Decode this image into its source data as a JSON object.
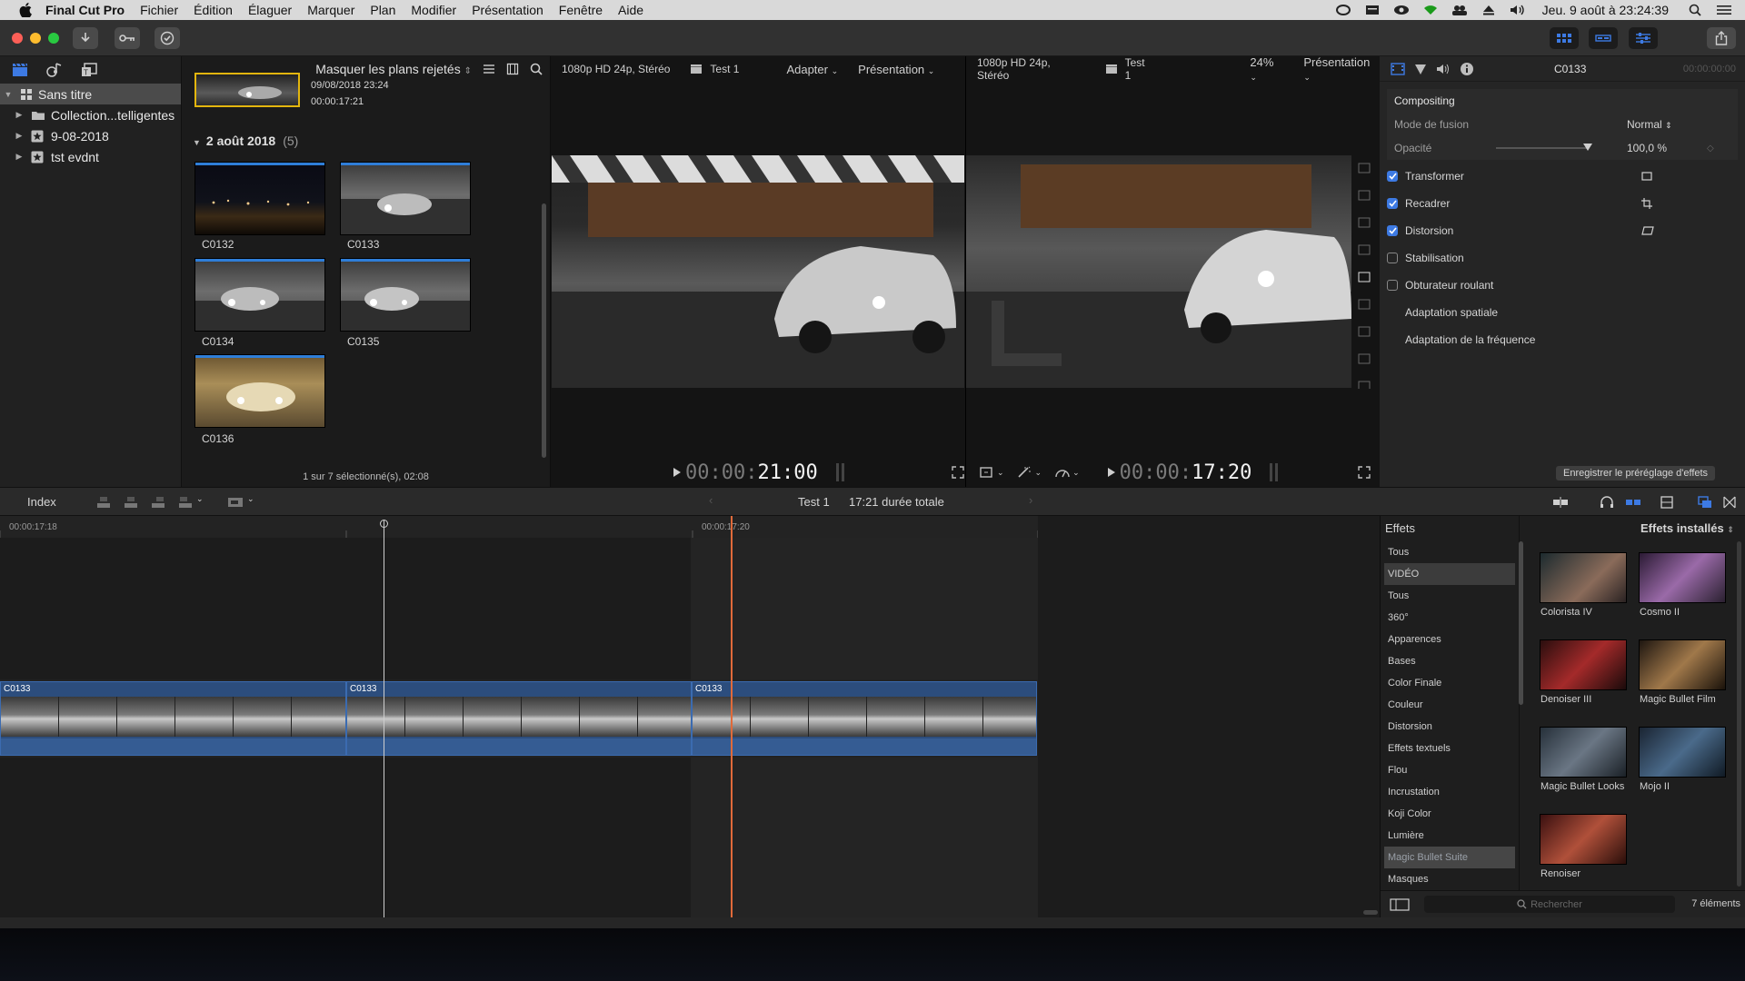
{
  "menubar": {
    "app_name": "Final Cut Pro",
    "items": [
      "Fichier",
      "Édition",
      "Élaguer",
      "Marquer",
      "Plan",
      "Modifier",
      "Présentation",
      "Fenêtre",
      "Aide"
    ],
    "clock": "Jeu. 9 août à  23:24:39"
  },
  "libraries": {
    "items": [
      {
        "label": "Sans titre",
        "expanded": true
      },
      {
        "label": "Collection...telligentes",
        "expanded": false
      },
      {
        "label": "9-08-2018",
        "expanded": false
      },
      {
        "label": "tst evdnt",
        "expanded": false
      }
    ]
  },
  "browser": {
    "filter": "Masquer les plans rejetés",
    "top_clip": {
      "date": "09/08/2018 23:24",
      "duration": "00:00:17:21"
    },
    "group_title": "2 août 2018",
    "group_count": "(5)",
    "clips": [
      "C0132",
      "C0133",
      "C0134",
      "C0135",
      "C0136"
    ],
    "footer": "1 sur 7 sélectionné(s), 02:08"
  },
  "viewer_left": {
    "format": "1080p HD 24p, Stéréo",
    "project": "Test 1",
    "zoom": "Adapter",
    "view": "Présentation",
    "timecode_dim": "00:00:",
    "timecode": "21:00"
  },
  "viewer_right": {
    "format": "1080p HD 24p, Stéréo",
    "project": "Test 1",
    "zoom": "24%",
    "view": "Présentation",
    "timecode_dim": "00:00:",
    "timecode": "17:20"
  },
  "inspector": {
    "clip_name": "C0133",
    "timecode": "00:00:00:00",
    "compositing": "Compositing",
    "blend_label": "Mode de fusion",
    "blend_value": "Normal",
    "opacity_label": "Opacité",
    "opacity_value": "100,0 %",
    "opacity_level": 1.0,
    "items": [
      {
        "label": "Transformer",
        "checked": true
      },
      {
        "label": "Recadrer",
        "checked": true
      },
      {
        "label": "Distorsion",
        "checked": true
      },
      {
        "label": "Stabilisation",
        "checked": false
      },
      {
        "label": "Obturateur roulant",
        "checked": false
      },
      {
        "label": "Adaptation spatiale"
      },
      {
        "label": "Adaptation de la fréquence"
      }
    ],
    "save_button": "Enregistrer le préréglage d'effets"
  },
  "timeline_bar": {
    "index": "Index",
    "project": "Test 1",
    "duration": "17:21 durée totale"
  },
  "timeline": {
    "ruler_left": "00:00:17:18",
    "ruler_mid": "00:00:17:20",
    "clips": [
      "C0133",
      "C0133",
      "C0133"
    ]
  },
  "effects": {
    "title": "Effets",
    "installed": "Effets installés",
    "categories": [
      "Tous",
      "VIDÉO",
      "Tous",
      "360°",
      "Apparences",
      "Bases",
      "Color Finale",
      "Couleur",
      "Distorsion",
      "Effets textuels",
      "Flou",
      "Incrustation",
      "Koji Color",
      "Lumière",
      "Magic Bullet Suite",
      "Masques"
    ],
    "items": [
      {
        "name": "Colorista IV"
      },
      {
        "name": "Cosmo II"
      },
      {
        "name": "Denoiser III"
      },
      {
        "name": "Magic Bullet Film"
      },
      {
        "name": "Magic Bullet Looks"
      },
      {
        "name": "Mojo II"
      },
      {
        "name": "Renoiser"
      }
    ],
    "search_placeholder": "Rechercher",
    "count": "7 éléments"
  }
}
